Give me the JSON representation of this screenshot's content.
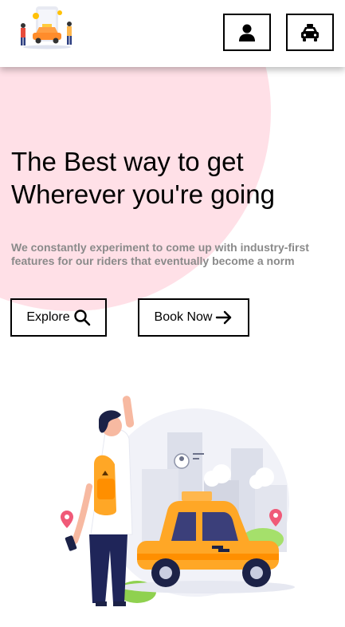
{
  "header": {
    "logo_icon": "taxi-app-logo",
    "user_button_icon": "user-icon",
    "taxi_button_icon": "taxi-icon"
  },
  "hero": {
    "headline_line1": "The Best way to get",
    "headline_line2": "Wherever you're going",
    "subtext": "We constantly experiment to come up with industry-first features for our riders that eventually become a norm",
    "explore_label": "Explore",
    "book_label": "Book Now"
  },
  "colors": {
    "blob": "#ffe0e7",
    "subtext": "#8a8a8a",
    "taxi_yellow": "#ffa726"
  }
}
